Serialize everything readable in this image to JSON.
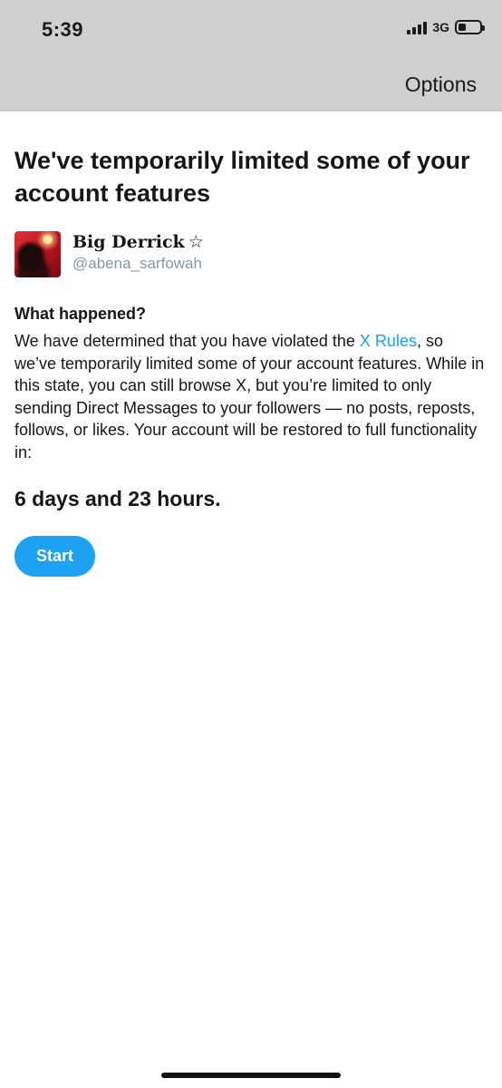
{
  "status_bar": {
    "time": "5:39",
    "network": "3G",
    "icons": [
      "signal-icon",
      "battery-icon"
    ]
  },
  "nav": {
    "options_label": "Options"
  },
  "page": {
    "title": "We've temporarily limited some of your account features"
  },
  "profile": {
    "display_name": "Big Derrick",
    "badge": "☆",
    "handle": "@abena_sarfowah"
  },
  "notice": {
    "heading": "What happened?",
    "text_before_link": "We have determined that you have violated the ",
    "link_text": "X Rules",
    "text_after_link": ", so we’ve temporarily limited some of your account features. While in this state, you can still browse X, but you’re limited to only sending Direct Messages to your followers — no posts, reposts, follows, or likes. Your account will be restored to full functionality in:"
  },
  "restriction": {
    "remaining": "6 days and 23 hours."
  },
  "actions": {
    "start_label": "Start"
  },
  "colors": {
    "accent": "#1da1f2",
    "header_bg": "#cfcfcf",
    "text": "#14171a",
    "muted": "#8a96a3"
  }
}
